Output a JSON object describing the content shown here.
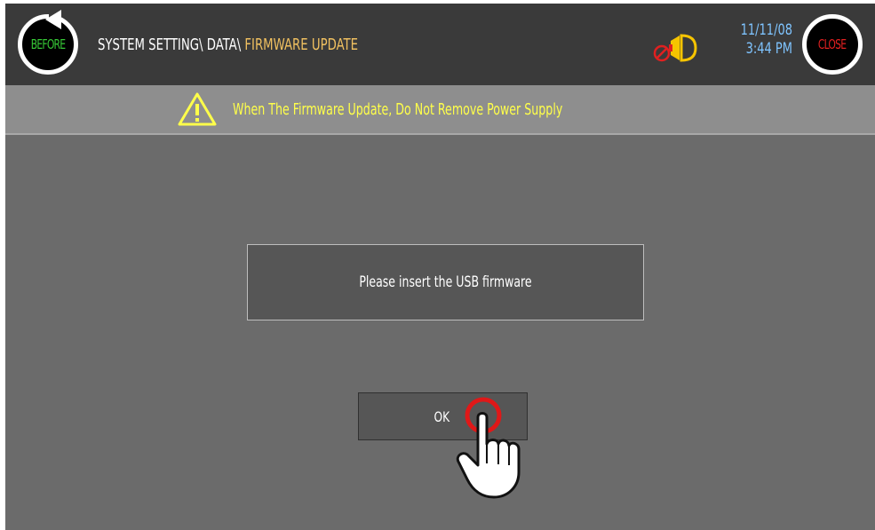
{
  "header": {
    "before_label": "BEFORE",
    "close_label": "CLOSE",
    "breadcrumb_path": "SYSTEM SETTING\\ DATA\\ ",
    "breadcrumb_current": "FIRMWARE UPDATE",
    "date": "11/11/08",
    "time": "3:44 PM",
    "status_icon": "buzzer-off-icon"
  },
  "banner": {
    "icon": "warning-icon",
    "text": "When The Firmware Update, Do Not Remove Power Supply"
  },
  "dialog": {
    "message": "Please insert the USB firmware",
    "ok_label": "OK"
  },
  "colors": {
    "background": "#6b6b6b",
    "topbar": "#3a3a3a",
    "banner": "#8e8e8e",
    "warning_text": "#ffff4a",
    "breadcrumb_current": "#f0c060",
    "datetime": "#7fc4ff",
    "before_label": "#36c836",
    "close_label": "#e12020"
  }
}
